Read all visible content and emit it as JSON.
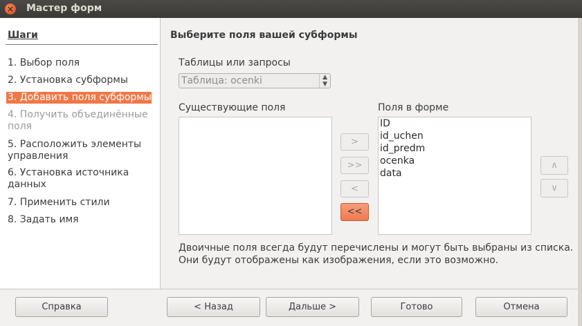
{
  "window": {
    "title": "Мастер форм"
  },
  "sidebar": {
    "title": "Шаги",
    "steps": [
      {
        "label": "1. Выбор поля",
        "state": "normal"
      },
      {
        "label": "2. Установка субформы",
        "state": "normal"
      },
      {
        "label": "3. Добавить поля субформы",
        "state": "active"
      },
      {
        "label": "4. Получить объединённые поля",
        "line1": "4. Получить объединённые",
        "line2": "поля",
        "state": "disabled"
      },
      {
        "label": "5. Расположить элементы управления",
        "line1": "5. Расположить элементы",
        "line2": "управления",
        "state": "normal"
      },
      {
        "label": "6. Установка источника данных",
        "line1": "6. Установка источника",
        "line2": "данных",
        "state": "normal"
      },
      {
        "label": "7. Применить стили",
        "state": "normal"
      },
      {
        "label": "8. Задать имя",
        "state": "normal"
      }
    ]
  },
  "main": {
    "title": "Выберите поля вашей субформы",
    "tables_label": "Таблицы или запросы",
    "tables_select": {
      "value": "Таблица: ocenki"
    },
    "existing_fields_label": "Существующие поля",
    "existing_fields": [],
    "form_fields_label": "Поля в форме",
    "form_fields": [
      "ID",
      "id_uchen",
      "id_predm",
      "ocenka",
      "data"
    ],
    "move_buttons": {
      "add": ">",
      "add_all": ">>",
      "remove": "<",
      "remove_all": "<<"
    },
    "order_buttons": {
      "up": "∧",
      "down": "∨"
    },
    "info_line1": "Двоичные поля всегда будут перечислены и могут быть выбраны из списка.",
    "info_line2": "Они будут отображены как изображения, если это возможно."
  },
  "footer": {
    "help": "Справка",
    "back": "< Назад",
    "next": "Дальше >",
    "finish": "Готово",
    "cancel": "Отмена"
  },
  "colors": {
    "accent": "#f07746",
    "titlebar": "#3c3b37",
    "close": "#e95420"
  }
}
